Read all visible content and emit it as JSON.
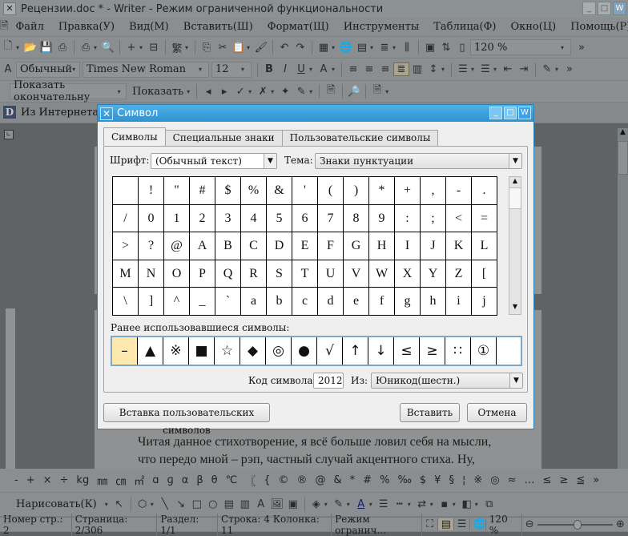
{
  "window": {
    "title": "Рецензии.doc * - Writer - Режим ограниченной функциональности"
  },
  "menu": [
    "Файл",
    "Правка(У)",
    "Вид(М)",
    "Вставить(Ш)",
    "Формат(Щ)",
    "Инструменты",
    "Таблица(Ф)",
    "Окно(Ц)",
    "Помощь(Р)"
  ],
  "toolbar": {
    "zoom": "120 %"
  },
  "formatting": {
    "style": "Обычный",
    "font": "Times New Roman",
    "size": "12"
  },
  "review": {
    "show_mode": "Показать окончательну",
    "show": "Показать"
  },
  "doc_tab": "Из Интернета",
  "dialog": {
    "title": "Символ",
    "tabs": [
      "Символы",
      "Специальные знаки",
      "Пользовательские символы"
    ],
    "font_label": "Шрифт:",
    "font_value": "(Обычный текст)",
    "theme_label": "Тема:",
    "theme_value": "Знаки пунктуации",
    "symbols": [
      " ",
      "!",
      "\"",
      "#",
      "$",
      "%",
      "&",
      "'",
      "(",
      ")",
      "*",
      "+",
      ",",
      "-",
      ".",
      "/",
      "0",
      "1",
      "2",
      "3",
      "4",
      "5",
      "6",
      "7",
      "8",
      "9",
      ":",
      ";",
      "<",
      "=",
      ">",
      "?",
      "@",
      "A",
      "B",
      "C",
      "D",
      "E",
      "F",
      "G",
      "H",
      "I",
      "J",
      "K",
      "L",
      "M",
      "N",
      "O",
      "P",
      "Q",
      "R",
      "S",
      "T",
      "U",
      "V",
      "W",
      "X",
      "Y",
      "Z",
      "[",
      "\\",
      "]",
      "^",
      "_",
      "`",
      "a",
      "b",
      "c",
      "d",
      "e",
      "f",
      "g",
      "h",
      "i",
      "j"
    ],
    "recent_label": "Ранее использовавшиеся символы:",
    "recent": [
      "–",
      "▲",
      "※",
      "■",
      "☆",
      "◆",
      "◎",
      "●",
      "√",
      "↑",
      "↓",
      "≤",
      "≥",
      "∷",
      "①",
      ""
    ],
    "code_label": "Код символа:",
    "code_value": "2012",
    "from_label": "Из:",
    "from_value": "Юникод(шестн.)",
    "custom_button": "Вставка пользовательских символов",
    "insert_button": "Вставить",
    "cancel_button": "Отмена"
  },
  "document": {
    "lines": [
      "Читая данное стихотворение, я всё больше ловил себя на мысли,",
      "что передо мной –  рэп, частный случай акцентного стиха. Ну,"
    ]
  },
  "symbol_bar": [
    "-",
    "+",
    "×",
    "÷",
    "kg",
    "㎜",
    "㎝",
    "㎡",
    "ɑ",
    "ɡ",
    "α",
    "β",
    "θ",
    "℃",
    "〖",
    "{",
    "©",
    "®",
    "@",
    "&",
    "*",
    "#",
    "%",
    "‰",
    "$",
    "¥",
    "§",
    "¦",
    "※",
    "◎",
    "≈",
    "…",
    "≤",
    "≥",
    "≦",
    "»"
  ],
  "drawing": {
    "draw_label": "Нарисовать(К)"
  },
  "status": [
    "Номер стр.: 2",
    "Страница: 2/306",
    "Раздел: 1/1",
    "Строка: 4  Колонка: 11",
    "Режим огранич...",
    "120 %"
  ],
  "zoom_slider": 0.5
}
